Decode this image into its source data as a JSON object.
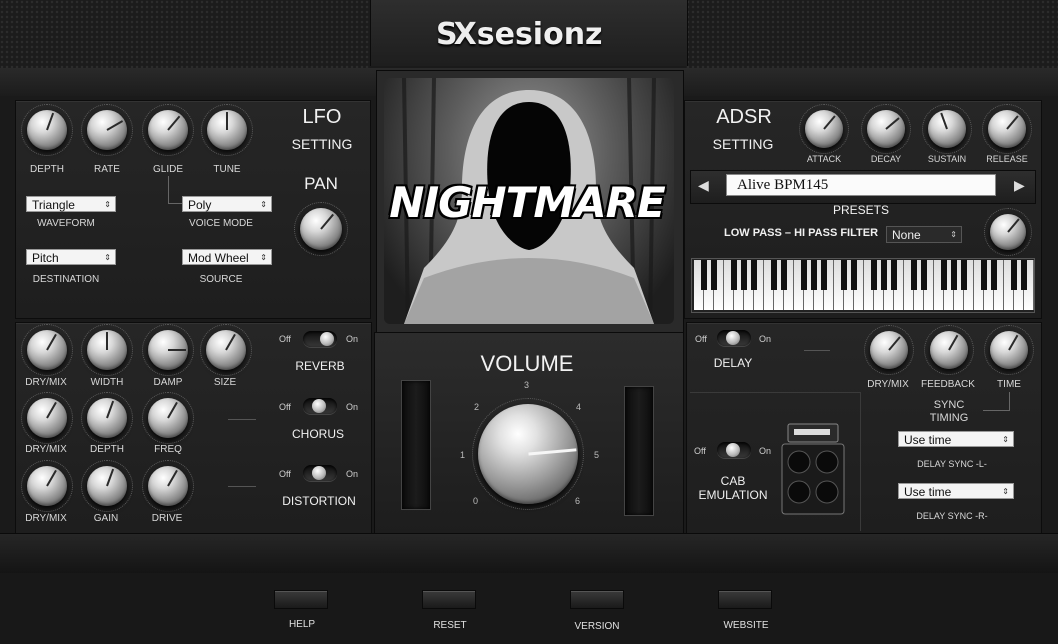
{
  "brand": {
    "logo_mark": "SX",
    "name": "sesionz"
  },
  "cover": {
    "title": "NIGHTMARE"
  },
  "lfo": {
    "title": "LFO",
    "subtitle": "SETTING",
    "knobs": [
      {
        "label": "DEPTH"
      },
      {
        "label": "RATE"
      },
      {
        "label": "GLIDE"
      },
      {
        "label": "TUNE"
      }
    ],
    "waveform": {
      "value": "Triangle",
      "label": "WAVEFORM"
    },
    "voice_mode": {
      "value": "Poly",
      "label": "VOICE MODE"
    },
    "destination": {
      "value": "Pitch",
      "label": "DESTINATION"
    },
    "source": {
      "value": "Mod Wheel",
      "label": "SOURCE"
    }
  },
  "pan": {
    "label": "PAN"
  },
  "adsr": {
    "title": "ADSR",
    "subtitle": "SETTING",
    "knobs": [
      {
        "label": "ATTACK"
      },
      {
        "label": "DECAY"
      },
      {
        "label": "SUSTAIN"
      },
      {
        "label": "RELEASE"
      }
    ]
  },
  "presets": {
    "current": "Alive BPM145",
    "label": "PRESETS",
    "prev_icon": "triangle-left",
    "next_icon": "triangle-right"
  },
  "filter": {
    "label": "LOW PASS – HI PASS FILTER",
    "value": "None"
  },
  "fx": {
    "reverb": {
      "name": "REVERB",
      "off": "Off",
      "on": "On",
      "knobs": [
        "DRY/MIX",
        "WIDTH",
        "DAMP",
        "SIZE"
      ]
    },
    "chorus": {
      "name": "CHORUS",
      "off": "Off",
      "on": "On",
      "knobs": [
        "DRY/MIX",
        "DEPTH",
        "FREQ"
      ]
    },
    "distortion": {
      "name": "DISTORTION",
      "off": "Off",
      "on": "On",
      "knobs": [
        "DRY/MIX",
        "GAIN",
        "DRIVE"
      ]
    }
  },
  "volume": {
    "label": "VOLUME",
    "scale": [
      "0",
      "1",
      "2",
      "3",
      "4",
      "5",
      "6"
    ]
  },
  "delay": {
    "name": "DELAY",
    "off": "Off",
    "on": "On",
    "knobs": [
      "DRY/MIX",
      "FEEDBACK",
      "TIME"
    ],
    "sync_label_1": "SYNC",
    "sync_label_2": "TIMING",
    "sync_l": {
      "value": "Use time",
      "label": "DELAY SYNC -L-"
    },
    "sync_r": {
      "value": "Use time",
      "label": "DELAY SYNC -R-"
    }
  },
  "cab": {
    "name_1": "CAB",
    "name_2": "EMULATION",
    "off": "Off",
    "on": "On"
  },
  "footer": {
    "help": "HELP",
    "reset": "RESET",
    "version": "VERSION",
    "website": "WEBSITE"
  },
  "icons": {
    "dropdown": "updown-arrows-icon",
    "cab": "speaker-cabinet-icon"
  }
}
